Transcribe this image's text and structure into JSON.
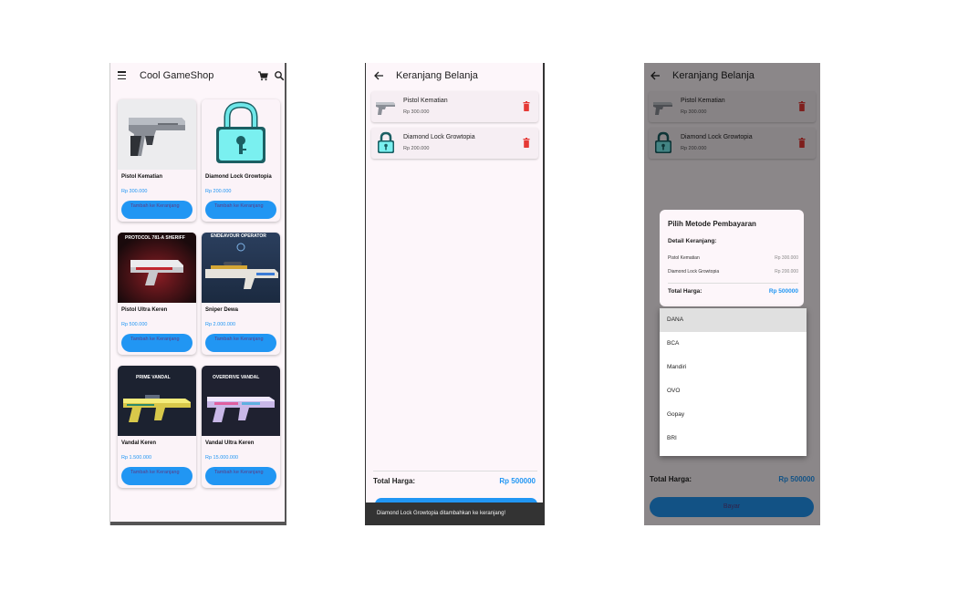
{
  "shop": {
    "title": "Cool GameShop",
    "icons": [
      "menu-icon",
      "cart-icon",
      "search-icon"
    ],
    "button_label": "Tambah ke Keranjang",
    "products": [
      {
        "name": "Pistol Kematian",
        "price": "Rp 300.000",
        "image_icon": "pistol-icon"
      },
      {
        "name": "Diamond Lock Growtopia",
        "price": "Rp 200.000",
        "image_icon": "diamond-lock-icon"
      },
      {
        "name": "Pistol Ultra Keren",
        "price": "Rp 500.000",
        "image_icon": "pistol-skin-icon",
        "banner": "PROTOCOL 781-A SHERIFF"
      },
      {
        "name": "Sniper Dewa",
        "price": "Rp 2.000.000",
        "image_icon": "sniper-icon",
        "banner": "ENDEAVOUR OPERATOR"
      },
      {
        "name": "Vandal Keren",
        "price": "Rp 1.500.000",
        "image_icon": "vandal-icon",
        "banner": "PRIME VANDAL"
      },
      {
        "name": "Vandal Ultra Keren",
        "price": "Rp 15.000.000",
        "image_icon": "vandal-ultra-icon",
        "banner": "OVERDRIVE VANDAL"
      }
    ]
  },
  "cart": {
    "title": "Keranjang Belanja",
    "items": [
      {
        "name": "Pistol Kematian",
        "price": "Rp 300.000"
      },
      {
        "name": "Diamond Lock Growtopia",
        "price": "Rp 200.000"
      }
    ],
    "total_label": "Total Harga:",
    "total_value": "Rp 500000",
    "snackbar": "Diamond Lock Growtopia ditambahkan ke keranjang!"
  },
  "payment": {
    "pay_button": "Bayar",
    "dialog_title": "Pilih Metode Pembayaran",
    "detail_label": "Detail Keranjang:",
    "rows": [
      {
        "name": "Pistol Kematian",
        "price": "Rp 300.000"
      },
      {
        "name": "Diamond Lock Growtopia",
        "price": "Rp 200.000"
      }
    ],
    "total_label": "Total Harga:",
    "total_value": "Rp 500000",
    "methods": [
      "DANA",
      "BCA",
      "Mandiri",
      "OVO",
      "Gopay",
      "BRI"
    ],
    "selected_method": "DANA"
  },
  "colors": {
    "accent": "#2196f3",
    "delete": "#e53935",
    "background": "#fdf6fa",
    "snackbar": "#333333"
  }
}
